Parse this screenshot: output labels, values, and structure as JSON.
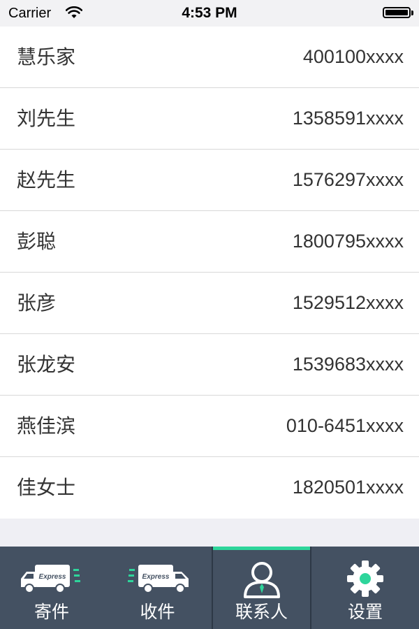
{
  "status_bar": {
    "carrier": "Carrier",
    "time": "4:53 PM",
    "battery_level": 1.0
  },
  "contacts": [
    {
      "name": "慧乐家",
      "phone": "400100xxxx"
    },
    {
      "name": "刘先生",
      "phone": "1358591xxxx"
    },
    {
      "name": "赵先生",
      "phone": "1576297xxxx"
    },
    {
      "name": "彭聪",
      "phone": "1800795xxxx"
    },
    {
      "name": "张彦",
      "phone": "1529512xxxx"
    },
    {
      "name": "张龙安",
      "phone": "1539683xxxx"
    },
    {
      "name": "燕佳滨",
      "phone": "010-6451xxxx"
    },
    {
      "name": "佳女士",
      "phone": "1820501xxxx"
    }
  ],
  "tab_bar": {
    "tabs": [
      {
        "label": "寄件",
        "icon": "truck-send-icon",
        "truck_text": "Express",
        "selected": false
      },
      {
        "label": "收件",
        "icon": "truck-receive-icon",
        "truck_text": "Express",
        "selected": false
      },
      {
        "label": "联系人",
        "icon": "person-icon",
        "selected": true
      },
      {
        "label": "设置",
        "icon": "gear-icon",
        "selected": false
      }
    ]
  },
  "colors": {
    "tab_bar_bg": "#445162",
    "accent": "#2ed59b",
    "text": "#333333",
    "background": "#efeff4"
  }
}
